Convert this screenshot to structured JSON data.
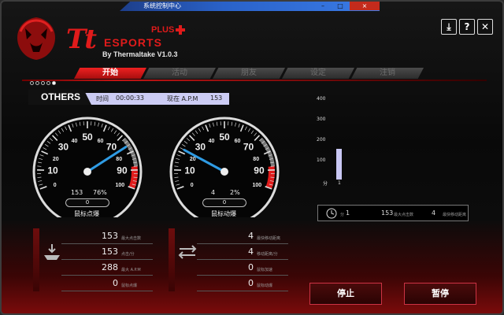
{
  "title_strip": {
    "text": "系统控制中心"
  },
  "window_buttons": [
    "–",
    "□",
    "×"
  ],
  "brand": {
    "tt": "Tt",
    "esports": "ESPORTS",
    "plus": "PLUS",
    "byline": "By Thermaltake V1.0.3"
  },
  "corner_buttons": [
    {
      "icon": "download-icon",
      "glyph": "⤓"
    },
    {
      "icon": "help-icon",
      "glyph": "?"
    },
    {
      "icon": "close-icon",
      "glyph": "✕"
    }
  ],
  "tabs": [
    {
      "label": "开始",
      "active": true
    },
    {
      "label": "活动",
      "active": false
    },
    {
      "label": "朋友",
      "active": false
    },
    {
      "label": "设定",
      "active": false
    },
    {
      "label": "注销",
      "active": false
    }
  ],
  "others": {
    "label": "OTHERS",
    "time_label": "时间",
    "time_value": "00:00:33",
    "now_label": "现在 A.P.M",
    "now_value": "153"
  },
  "gauges": [
    {
      "name": "鼠标点爆",
      "value": 76,
      "left_readout": "153",
      "right_readout": "76%",
      "counter": "0",
      "ticks": [
        "0",
        "10",
        "20",
        "30",
        "40",
        "50",
        "60",
        "70",
        "80",
        "90",
        "100"
      ]
    },
    {
      "name": "鼠标动爆",
      "value": 22,
      "left_readout": "4",
      "right_readout": "2%",
      "counter": "0",
      "ticks": [
        "0",
        "10",
        "20",
        "30",
        "40",
        "50",
        "60",
        "70",
        "80",
        "90",
        "100"
      ]
    }
  ],
  "stats_left": {
    "icon": "mouse-click-icon",
    "rows": [
      {
        "value": "153",
        "label": "最大点击数"
      },
      {
        "value": "153",
        "label": "点击/分"
      },
      {
        "value": "288",
        "label": "最大 A.P.M"
      },
      {
        "value": "0",
        "label": "鼠标点爆"
      }
    ]
  },
  "stats_right": {
    "icon": "mouse-move-icon",
    "rows": [
      {
        "value": "4",
        "label": "最快移动距离"
      },
      {
        "value": "4",
        "label": "移动距离/分"
      },
      {
        "value": "0",
        "label": "鼠标加速"
      },
      {
        "value": "0",
        "label": "鼠标动爆"
      }
    ]
  },
  "chart_data": {
    "type": "bar",
    "categories": [
      "1"
    ],
    "values": [
      153
    ],
    "yticks": [
      "400",
      "300",
      "200",
      "100"
    ],
    "ylabel": "分",
    "ylim": [
      0,
      400
    ]
  },
  "summary": {
    "icon": "clock-icon",
    "minutes": "1",
    "min_label": "分",
    "max_apm": "153",
    "max_apm_label": "最大点击数",
    "max_move": "4",
    "max_move_label": "最快移动距离"
  },
  "buttons": {
    "stop": "停止",
    "pause": "暂停"
  },
  "colors": {
    "accent": "#e01b1b",
    "bar": "#c9c7f4",
    "needle": "#2f9be3"
  }
}
